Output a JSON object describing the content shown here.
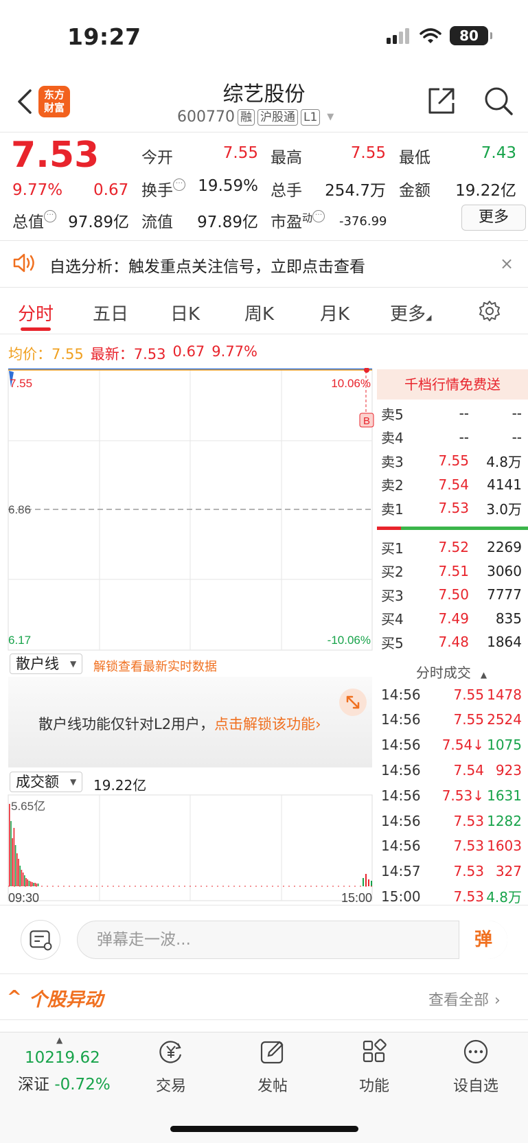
{
  "status_bar": {
    "time": "19:27",
    "battery": "80"
  },
  "header": {
    "logo_line1": "东方",
    "logo_line2": "财富",
    "stock_name": "综艺股份",
    "stock_code": "600770",
    "tags": [
      "融",
      "沪股通",
      "L1"
    ]
  },
  "quote": {
    "price": "7.53",
    "change_pct": "9.77%",
    "change_amt": "0.67",
    "open_label": "今开",
    "open": "7.55",
    "high_label": "最高",
    "high": "7.55",
    "low_label": "最低",
    "low": "7.43",
    "turnover_label": "换手",
    "turnover": "19.59%",
    "volume_label": "总手",
    "volume": "254.7万",
    "amount_label": "金额",
    "amount": "19.22亿",
    "mktcap_label": "总值",
    "mktcap": "97.89亿",
    "float_label": "流值",
    "float": "97.89亿",
    "pe_label": "市盈",
    "pe_sup": "动",
    "pe": "-376.99",
    "more": "更多"
  },
  "notice": {
    "text": "自选分析：触发重点关注信号，立即点击查看",
    "close": "×"
  },
  "tabs": [
    "分时",
    "五日",
    "日K",
    "周K",
    "月K",
    "更多"
  ],
  "info_line": {
    "avg_label": "均价：",
    "avg": "7.55",
    "latest_label": "最新：",
    "latest": "7.53",
    "chg": "0.67",
    "pct": "9.77%"
  },
  "chart_data": {
    "type": "line",
    "y_left_ticks": [
      "7.55",
      "6.86",
      "6.17"
    ],
    "y_right_ticks": [
      "10.06%",
      "-10.06%"
    ],
    "ylim": [
      6.17,
      7.55
    ],
    "baseline": 6.86,
    "x_ticks": [
      "09:30",
      "15:00"
    ],
    "marker": "B",
    "volume_max_label": "5.65亿",
    "volume_total": "19.22亿",
    "volume_label": "成交额"
  },
  "retail_panel": {
    "select": "散户线",
    "unlock_hint": "解锁查看最新实时数据",
    "text": "散户线功能仅针对L2用户，",
    "link": "点击解锁该功能"
  },
  "order_book": {
    "promo": "千档行情免费送",
    "asks": [
      {
        "label": "卖5",
        "price": "--",
        "vol": "--"
      },
      {
        "label": "卖4",
        "price": "--",
        "vol": "--"
      },
      {
        "label": "卖3",
        "price": "7.55",
        "vol": "4.8万"
      },
      {
        "label": "卖2",
        "price": "7.54",
        "vol": "4141"
      },
      {
        "label": "卖1",
        "price": "7.53",
        "vol": "3.0万"
      }
    ],
    "bids": [
      {
        "label": "买1",
        "price": "7.52",
        "vol": "2269"
      },
      {
        "label": "买2",
        "price": "7.51",
        "vol": "3060"
      },
      {
        "label": "买3",
        "price": "7.50",
        "vol": "7777"
      },
      {
        "label": "买4",
        "price": "7.49",
        "vol": "835"
      },
      {
        "label": "买5",
        "price": "7.48",
        "vol": "1864"
      }
    ]
  },
  "trades": {
    "title": "分时成交",
    "rows": [
      {
        "time": "14:56",
        "price": "7.55",
        "vol": "1478",
        "dir": "red"
      },
      {
        "time": "14:56",
        "price": "7.55",
        "vol": "2524",
        "dir": "red"
      },
      {
        "time": "14:56",
        "price": "7.54↓",
        "vol": "1075",
        "dir": "green"
      },
      {
        "time": "14:56",
        "price": "7.54",
        "vol": "923",
        "dir": "red"
      },
      {
        "time": "14:56",
        "price": "7.53↓",
        "vol": "1631",
        "dir": "green"
      },
      {
        "time": "14:56",
        "price": "7.53",
        "vol": "1282",
        "dir": "green"
      },
      {
        "time": "14:56",
        "price": "7.53",
        "vol": "1603",
        "dir": "red"
      },
      {
        "time": "14:57",
        "price": "7.53",
        "vol": "327",
        "dir": "red"
      },
      {
        "time": "15:00",
        "price": "7.53",
        "vol": "4.8万",
        "dir": "green"
      }
    ]
  },
  "barrage": {
    "placeholder": "弹幕走一波...",
    "send": "弹"
  },
  "movers": {
    "title": "个股异动",
    "view_all": "查看全部"
  },
  "bottom_nav": {
    "index_value": "10219.62",
    "index_label": "深证",
    "index_change": "-0.72%",
    "items": [
      "交易",
      "发帖",
      "功能",
      "设自选"
    ]
  },
  "colors": {
    "up": "#e8242c",
    "down": "#17a34a",
    "accent": "#f07020",
    "avg_line": "#f0a020"
  }
}
